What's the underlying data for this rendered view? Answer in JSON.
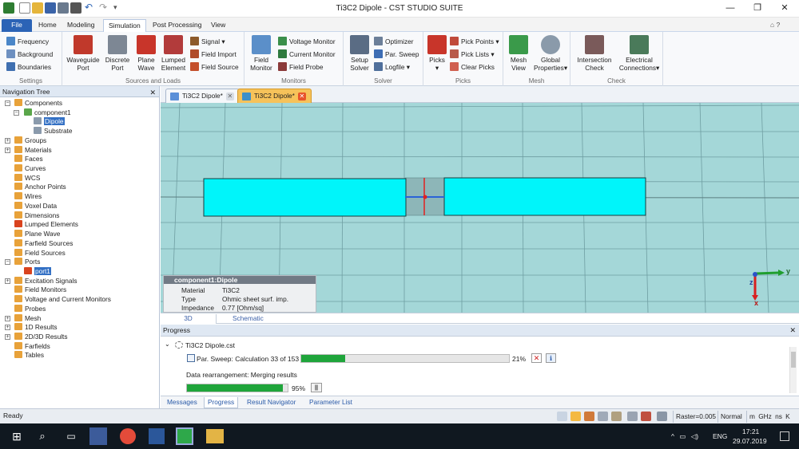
{
  "window": {
    "title": "Ti3C2 Dipole - CST STUDIO SUITE",
    "minimize": "—",
    "restore": "❐",
    "close": "✕"
  },
  "menu": {
    "tabs": [
      "File",
      "Home",
      "Modeling",
      "Simulation",
      "Post Processing",
      "View"
    ],
    "active": "Simulation",
    "help": "⌂ ?"
  },
  "ribbon": {
    "settings": {
      "items": [
        "Frequency",
        "Background",
        "Boundaries"
      ],
      "label": "Settings"
    },
    "sources": {
      "big": [
        {
          "l1": "Waveguide",
          "l2": "Port"
        },
        {
          "l1": "Discrete",
          "l2": "Port"
        },
        {
          "l1": "Plane",
          "l2": "Wave"
        },
        {
          "l1": "Lumped",
          "l2": "Element"
        }
      ],
      "small": [
        "Signal ▾",
        "Field Import",
        "Field Source"
      ],
      "label": "Sources and Loads"
    },
    "monitors": {
      "big": {
        "l1": "Field",
        "l2": "Monitor"
      },
      "small": [
        "Voltage Monitor",
        "Current Monitor",
        "Field Probe"
      ],
      "label": "Monitors"
    },
    "solver": {
      "big": {
        "l1": "Setup",
        "l2": "Solver"
      },
      "small": [
        "Optimizer",
        "Par. Sweep",
        "Logfile ▾"
      ],
      "label": "Solver"
    },
    "picks": {
      "big": {
        "l1": "Picks",
        "l2": "▾"
      },
      "small": [
        "Pick Points ▾",
        "Pick Lists ▾",
        "Clear Picks"
      ],
      "label": "Picks"
    },
    "mesh": {
      "big": [
        {
          "l1": "Mesh",
          "l2": "View"
        },
        {
          "l1": "Global",
          "l2": "Properties▾"
        }
      ],
      "label": "Mesh"
    },
    "check": {
      "big": [
        {
          "l1": "Intersection",
          "l2": "Check"
        },
        {
          "l1": "Electrical",
          "l2": "Connections▾"
        }
      ],
      "label": "Check"
    }
  },
  "nav": {
    "title": "Navigation Tree",
    "items": [
      "Components",
      "component1",
      "Dipole",
      "Substrate",
      "Groups",
      "Materials",
      "Faces",
      "Curves",
      "WCS",
      "Anchor Points",
      "Wires",
      "Voxel Data",
      "Dimensions",
      "Lumped Elements",
      "Plane Wave",
      "Farfield Sources",
      "Field Sources",
      "Ports",
      "port1",
      "Excitation Signals",
      "Field Monitors",
      "Voltage and Current Monitors",
      "Probes",
      "Mesh",
      "1D Results",
      "2D/3D Results",
      "Farfields",
      "Tables"
    ]
  },
  "doctabs": [
    "Ti3C2 Dipole*",
    "Ti3C2 Dipole*"
  ],
  "infobox": {
    "title": "component1:Dipole",
    "rows": [
      {
        "k": "Material",
        "v": "Ti3C2"
      },
      {
        "k": "Type",
        "v": "Ohmic sheet surf. imp."
      },
      {
        "k": "Impedance",
        "v": "0.77 [Ohm/sq]"
      }
    ]
  },
  "axes": {
    "y": "y",
    "z": "z",
    "x": "x"
  },
  "viewtabs": [
    "3D",
    "Schematic"
  ],
  "progress": {
    "title": "Progress",
    "file": "Ti3C2 Dipole.cst",
    "task1": "Par. Sweep: Calculation 33 of 153",
    "task1_pct": "21%",
    "task1_frac": 0.21,
    "task2": "Data rearrangement: Merging results",
    "task2_pct": "95%",
    "task2_frac": 0.95,
    "tabs": [
      "Messages",
      "Progress",
      "Result Navigator",
      "Parameter List"
    ]
  },
  "status": {
    "ready": "Ready",
    "raster": "Raster=0.005",
    "mode": "Normal",
    "units": "m  GHz  ns  K"
  },
  "taskbar": {
    "lang": "ENG",
    "time": "17:21",
    "date": "29.07.2019"
  },
  "colors": {
    "accent": "#2b63b6",
    "metal": "#00f5fa",
    "bg3d": "#a4d7d8",
    "progress": "#1fa53b"
  }
}
